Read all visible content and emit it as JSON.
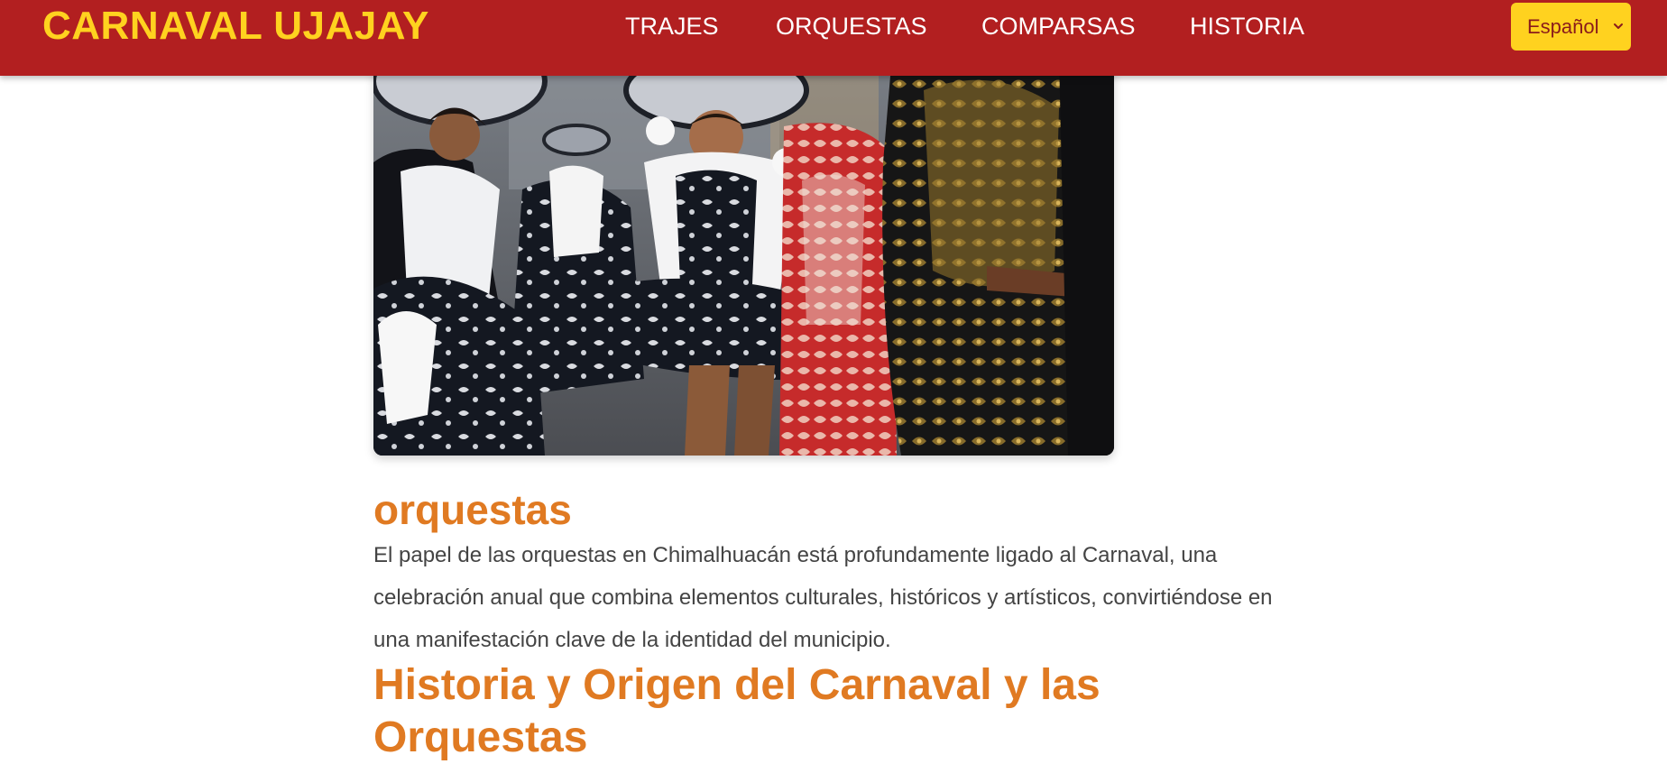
{
  "header": {
    "brand": "CARNAVAL UJAJAY",
    "nav": [
      "TRAJES",
      "ORQUESTAS",
      "COMPARSAS",
      "HISTORIA"
    ],
    "language": "Español"
  },
  "main": {
    "section_title": "orquestas",
    "paragraph": "El papel de las orquestas en Chimalhuacán está profundamente ligado al Carnaval, una celebración anual que combina elementos culturales, históricos y artísticos, convirtiéndose en una manifestación clave de la identidad del municipio.",
    "subheading": "Historia y Origen del Carnaval y las Orquestas"
  },
  "colors": {
    "header_bg": "#b21f20",
    "brand": "#ffd21f",
    "accent_orange": "#e07a22",
    "language_button": "#ffd21f"
  }
}
